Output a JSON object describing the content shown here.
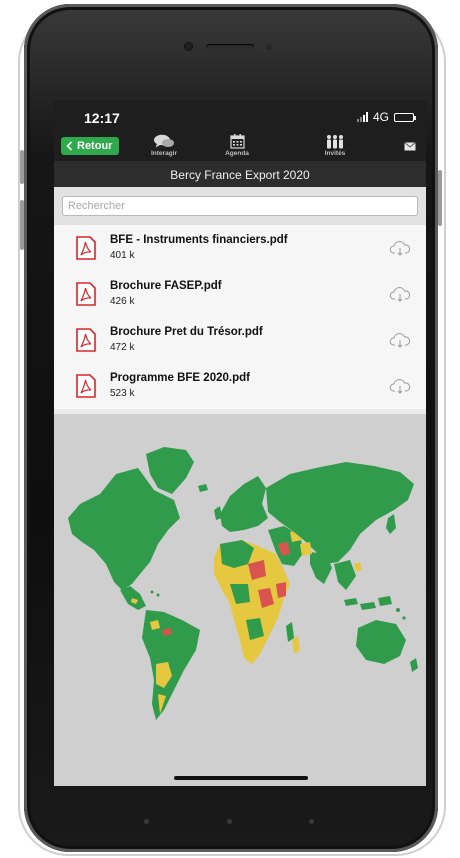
{
  "status": {
    "time": "12:17",
    "network": "4G"
  },
  "toolbar": {
    "back_label": "Retour",
    "items": [
      {
        "label": "Interagir",
        "icon": "chat-bubbles-icon"
      },
      {
        "label": "Agenda",
        "icon": "calendar-icon"
      },
      {
        "label": "Invités",
        "icon": "people-icon"
      }
    ],
    "mail_icon": "mail-icon"
  },
  "title": "Bercy France Export 2020",
  "search": {
    "placeholder": "Rechercher",
    "value": ""
  },
  "files": [
    {
      "name": "BFE - Instruments financiers.pdf",
      "size": "401 k"
    },
    {
      "name": "Brochure FASEP.pdf",
      "size": "426 k"
    },
    {
      "name": "Brochure Pret du Trésor.pdf",
      "size": "472 k"
    },
    {
      "name": "Programme BFE 2020.pdf",
      "size": "523 k"
    }
  ],
  "colors": {
    "back_button": "#2ea94b",
    "pdf_red": "#d6262c",
    "map_green": "#2f9b4b",
    "map_yellow": "#e6c840",
    "map_red": "#d9534f",
    "map_background": "#cfcfcf"
  }
}
